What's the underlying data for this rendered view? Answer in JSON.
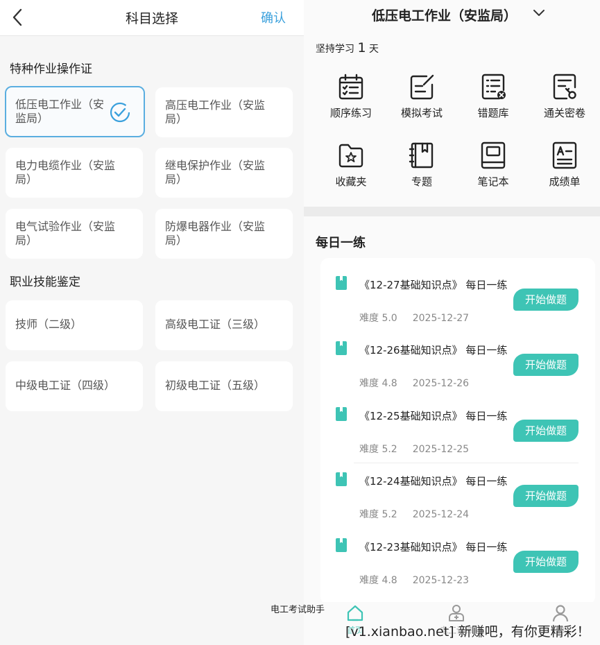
{
  "left": {
    "title": "科目选择",
    "confirm_label": "确认",
    "sections": [
      {
        "title": "特种作业操作证",
        "options": [
          {
            "line1": "低压电工作业（安",
            "line2": "监局）",
            "selected": true
          },
          {
            "line1": "高压电工作业（安监",
            "line2": "局）",
            "selected": false
          },
          {
            "line1": "电力电缆作业（安监",
            "line2": "局）",
            "selected": false
          },
          {
            "line1": "继电保护作业（安监",
            "line2": "局）",
            "selected": false
          },
          {
            "line1": "电气试验作业（安监",
            "line2": "局）",
            "selected": false
          },
          {
            "line1": "防爆电器作业（安监",
            "line2": "局）",
            "selected": false
          }
        ]
      },
      {
        "title": "职业技能鉴定",
        "options": [
          {
            "line1": "技师（二级）",
            "selected": false
          },
          {
            "line1": "高级电工证（三级）",
            "selected": false
          },
          {
            "line1": "中级电工证（四级）",
            "selected": false
          },
          {
            "line1": "初级电工证（五级）",
            "selected": false
          }
        ]
      }
    ]
  },
  "right": {
    "subject": "低压电工作业（安监局）",
    "streak_prefix": "坚持学习",
    "streak_days": "1",
    "streak_suffix": "天",
    "tools": [
      {
        "label": "顺序练习",
        "icon": "calendar-list-icon"
      },
      {
        "label": "模拟考试",
        "icon": "edit-note-icon"
      },
      {
        "label": "错题库",
        "icon": "wrong-list-icon"
      },
      {
        "label": "通关密卷",
        "icon": "key-paper-icon"
      },
      {
        "label": "收藏夹",
        "icon": "star-folder-icon"
      },
      {
        "label": "专题",
        "icon": "bookmark-book-icon"
      },
      {
        "label": "笔记本",
        "icon": "notebook-icon"
      },
      {
        "label": "成绩单",
        "icon": "grade-sheet-icon"
      }
    ],
    "daily_title": "每日一练",
    "daily_items": [
      {
        "title": "《12-27基础知识点》 每日一练",
        "difficulty": "难度 5.0",
        "date": "2025-12-27",
        "button": "开始做题"
      },
      {
        "title": "《12-26基础知识点》 每日一练",
        "difficulty": "难度 4.8",
        "date": "2025-12-26",
        "button": "开始做题"
      },
      {
        "title": "《12-25基础知识点》 每日一练",
        "difficulty": "难度 5.2",
        "date": "2025-12-25",
        "button": "开始做题"
      },
      {
        "title": "《12-24基础知识点》 每日一练",
        "difficulty": "难度 5.2",
        "date": "2025-12-24",
        "button": "开始做题"
      },
      {
        "title": "《12-23基础知识点》 每日一练",
        "difficulty": "难度 4.8",
        "date": "2025-12-23",
        "button": "开始做题"
      }
    ],
    "tabs": [
      {
        "label": "首页",
        "icon": "home-icon",
        "active": true
      },
      {
        "label": "电工计算",
        "icon": "calculator-person-icon",
        "active": false
      },
      {
        "label": "我的",
        "icon": "user-icon",
        "active": false
      }
    ],
    "accent_color": "#3ec4b5"
  },
  "overlay_text": "电工考试助手",
  "watermark": "[v1.xianbao.net] 新赚吧，有你更精彩！"
}
